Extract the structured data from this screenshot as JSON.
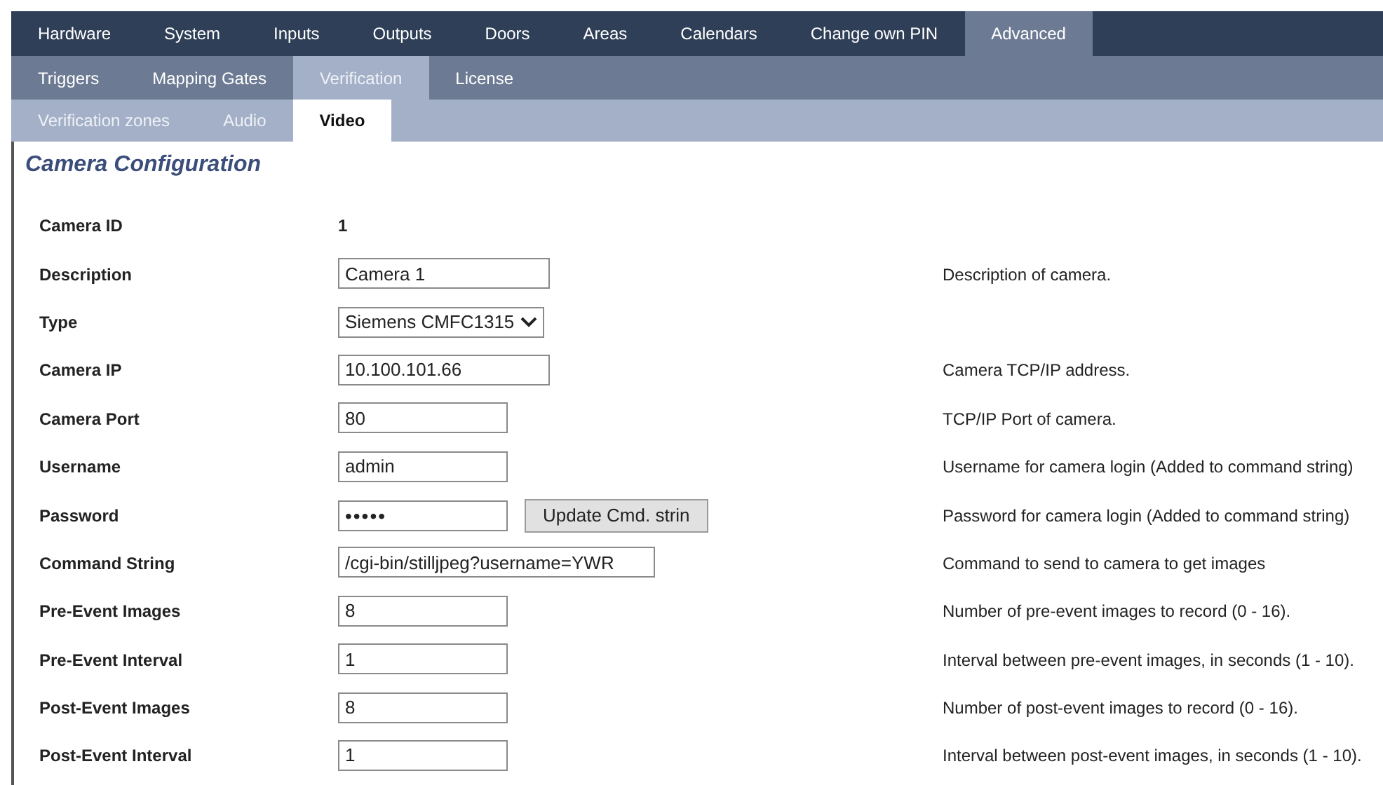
{
  "nav1": [
    {
      "label": "Hardware",
      "selected": false
    },
    {
      "label": "System",
      "selected": false
    },
    {
      "label": "Inputs",
      "selected": false
    },
    {
      "label": "Outputs",
      "selected": false
    },
    {
      "label": "Doors",
      "selected": false
    },
    {
      "label": "Areas",
      "selected": false
    },
    {
      "label": "Calendars",
      "selected": false
    },
    {
      "label": "Change own PIN",
      "selected": false
    },
    {
      "label": "Advanced",
      "selected": true
    }
  ],
  "nav2": [
    {
      "label": "Triggers",
      "selected": false
    },
    {
      "label": "Mapping Gates",
      "selected": false
    },
    {
      "label": "Verification",
      "selected": true
    },
    {
      "label": "License",
      "selected": false
    }
  ],
  "nav3": [
    {
      "label": "Verification zones",
      "selected": false
    },
    {
      "label": "Audio",
      "selected": false
    },
    {
      "label": "Video",
      "selected": true
    }
  ],
  "title": "Camera Configuration",
  "rows": [
    {
      "kind": "text",
      "label": "Camera ID",
      "value": "1"
    },
    {
      "kind": "wideinput",
      "label": "Description",
      "value": "Camera 1",
      "help": "Description of camera."
    },
    {
      "kind": "select",
      "label": "Type",
      "value": "Siemens CMFC1315"
    },
    {
      "kind": "wideinput",
      "label": "Camera IP",
      "value": "10.100.101.66",
      "help": "Camera TCP/IP address."
    },
    {
      "kind": "input",
      "label": "Camera Port",
      "value": "80",
      "help": "TCP/IP Port of camera."
    },
    {
      "kind": "input",
      "label": "Username",
      "value": "admin",
      "help": "Username for camera login (Added to command string)"
    },
    {
      "kind": "password",
      "label": "Password",
      "value": "•••••",
      "button": "Update Cmd. strin",
      "help": "Password for camera login (Added to command string)"
    },
    {
      "kind": "longinput",
      "label": "Command String",
      "value": "/cgi-bin/stilljpeg?username=YWR",
      "help": "Command to send to camera to get images"
    },
    {
      "kind": "input",
      "label": "Pre-Event Images",
      "value": "8",
      "help": "Number of pre-event images to record (0 - 16)."
    },
    {
      "kind": "input",
      "label": "Pre-Event Interval",
      "value": "1",
      "help": "Interval between pre-event images, in seconds (1 - 10)."
    },
    {
      "kind": "input",
      "label": "Post-Event Images",
      "value": "8",
      "help": "Number of post-event images to record (0 - 16)."
    },
    {
      "kind": "input",
      "label": "Post-Event Interval",
      "value": "1",
      "help": "Interval between post-event images, in seconds (1 - 10)."
    }
  ]
}
